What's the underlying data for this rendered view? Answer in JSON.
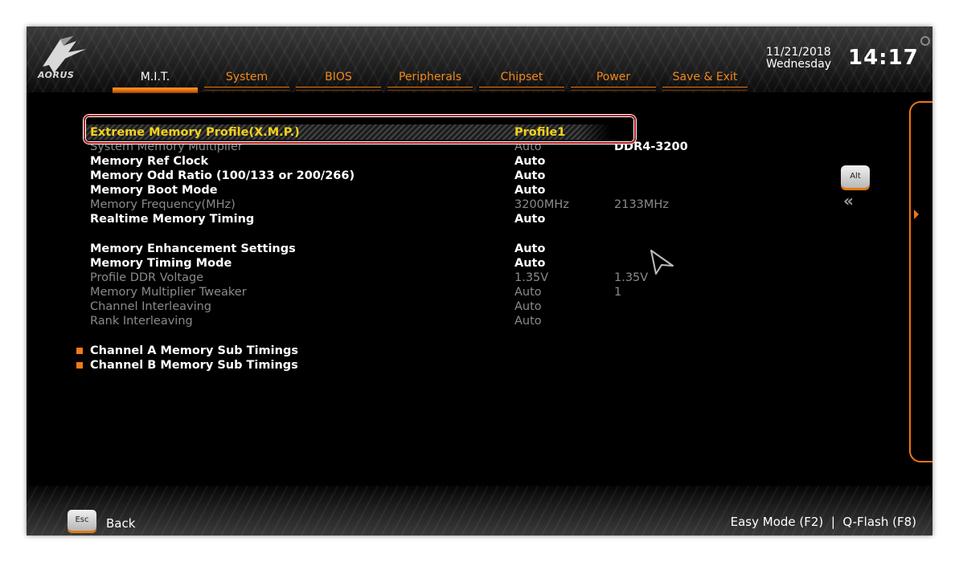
{
  "header": {
    "logo_text": "AORUS",
    "tabs": [
      {
        "label": "M.I.T.",
        "active": true
      },
      {
        "label": "System",
        "active": false
      },
      {
        "label": "BIOS",
        "active": false
      },
      {
        "label": "Peripherals",
        "active": false
      },
      {
        "label": "Chipset",
        "active": false
      },
      {
        "label": "Power",
        "active": false
      },
      {
        "label": "Save & Exit",
        "active": false
      }
    ],
    "date": "11/21/2018",
    "day": "Wednesday",
    "time": "14:17"
  },
  "settings": {
    "xmp": {
      "label": "Extreme Memory Profile(X.M.P.)",
      "value": "Profile1"
    },
    "system_memory_multiplier": {
      "label": "System Memory Multiplier",
      "value": "Auto",
      "extra": "DDR4-3200"
    },
    "memory_ref_clock": {
      "label": "Memory Ref Clock",
      "value": "Auto"
    },
    "memory_odd_ratio": {
      "label": "Memory Odd Ratio (100/133 or 200/266)",
      "value": "Auto"
    },
    "memory_boot_mode": {
      "label": "Memory Boot Mode",
      "value": "Auto"
    },
    "memory_frequency": {
      "label": "Memory Frequency(MHz)",
      "value": "3200MHz",
      "extra": "2133MHz"
    },
    "realtime_memory_timing": {
      "label": "Realtime Memory Timing",
      "value": "Auto"
    },
    "memory_enhancement_settings": {
      "label": "Memory Enhancement Settings",
      "value": "Auto"
    },
    "memory_timing_mode": {
      "label": "Memory Timing Mode",
      "value": "Auto"
    },
    "profile_ddr_voltage": {
      "label": "Profile DDR Voltage",
      "value": "1.35V",
      "extra": "1.35V"
    },
    "memory_multiplier_tweaker": {
      "label": "Memory Multiplier Tweaker",
      "value": "Auto",
      "extra": "1"
    },
    "channel_interleaving": {
      "label": "Channel Interleaving",
      "value": "Auto"
    },
    "rank_interleaving": {
      "label": "Rank Interleaving",
      "value": "Auto"
    }
  },
  "submenus": {
    "channel_a": "Channel A Memory Sub Timings",
    "channel_b": "Channel B Memory Sub Timings"
  },
  "side": {
    "alt_key": "Alt",
    "collapse_symbol": "«"
  },
  "footer": {
    "esc_key": "Esc",
    "back_label": "Back",
    "right_text": "Easy Mode (F2)  |  Q-Flash (F8)"
  },
  "colors": {
    "accent": "#ef7614",
    "selected_text": "#f2d21b",
    "enabled_text": "#ffffff",
    "disabled_text": "#8a8a8a",
    "highlight_box": "#b01a1a"
  }
}
